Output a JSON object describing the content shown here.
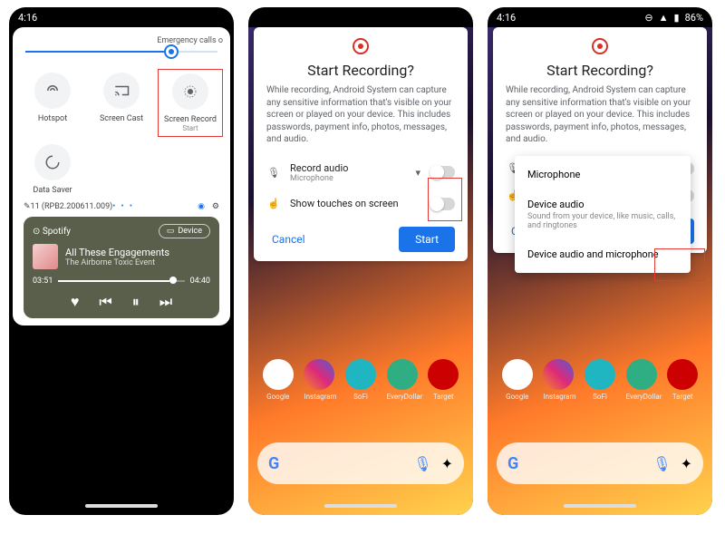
{
  "p1": {
    "time": "4:16",
    "emergency": "Emergency calls o",
    "tiles": [
      {
        "label": "Hotspot"
      },
      {
        "label": "Screen Cast"
      },
      {
        "label": "Screen Record",
        "sub": "Start"
      },
      {
        "label": "Data Saver"
      }
    ],
    "build": "11 (RPB2.200611.009)",
    "player": {
      "app": "Spotify",
      "device": "Device",
      "title": "All These Engagements",
      "artist": "The Airborne Toxic Event",
      "elapsed": "03:51",
      "total": "04:40"
    }
  },
  "dialog": {
    "title": "Start Recording?",
    "body": "While recording, Android System can capture any sensitive information that's visible on your screen or played on your device. This includes passwords, payment info, photos, messages, and audio.",
    "opt_audio_label": "Record audio",
    "opt_audio_sub": "Microphone",
    "opt_touch_label": "Show touches on screen",
    "cancel": "Cancel",
    "start": "Start"
  },
  "p3": {
    "time": "4:16",
    "battery": "86%",
    "menu": [
      {
        "label": "Microphone"
      },
      {
        "label": "Device audio",
        "sub": "Sound from your device, like music, calls, and ringtones"
      },
      {
        "label": "Device audio and microphone"
      }
    ]
  },
  "apps": [
    "Google",
    "Instagram",
    "SoFi",
    "EveryDollar",
    "Target"
  ]
}
